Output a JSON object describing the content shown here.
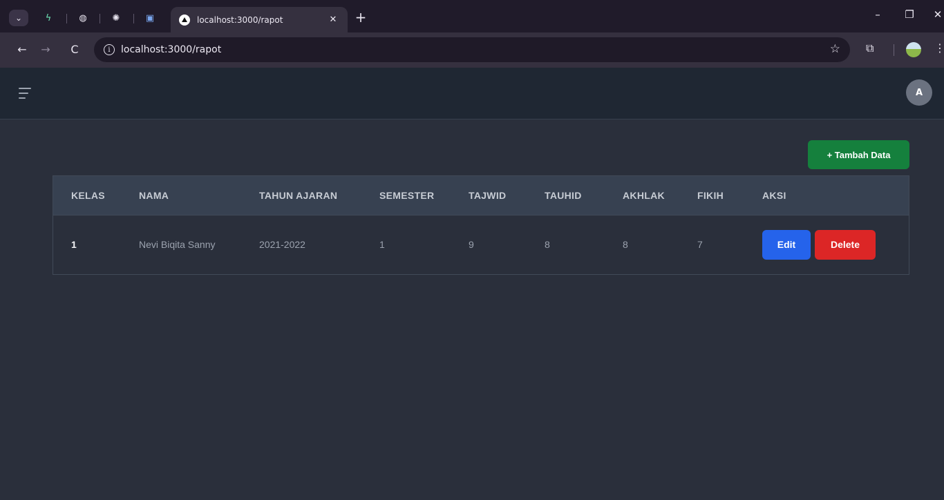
{
  "browser": {
    "tab_title": "localhost:3000/rapot",
    "tab_close": "✕",
    "new_tab": "+",
    "url": "localhost:3000/rapot",
    "minimize": "–",
    "restore": "❐",
    "close": "✕",
    "back": "←",
    "forward": "→",
    "reload": "C",
    "info": "i",
    "bookmark": "☆",
    "extensions": "⧉",
    "menu": "⋮"
  },
  "app": {
    "avatar_initial": "A",
    "add_button": "+ Tambah Data",
    "table": {
      "headers": [
        "KELAS",
        "NAMA",
        "TAHUN AJARAN",
        "SEMESTER",
        "TAJWID",
        "TAUHID",
        "AKHLAK",
        "FIKIH",
        "AKSI"
      ],
      "rows": [
        {
          "kelas": "1",
          "nama": "Nevi Biqita Sanny",
          "tahun_ajaran": "2021-2022",
          "semester": "1",
          "tajwid": "9",
          "tauhid": "8",
          "akhlak": "8",
          "fikih": "7",
          "edit_label": "Edit",
          "delete_label": "Delete"
        }
      ]
    }
  },
  "colors": {
    "add_button": "#15803d",
    "edit_button": "#2563eb",
    "delete_button": "#dc2626",
    "header_bg": "#1f2733",
    "page_bg": "#2a2f3b"
  }
}
